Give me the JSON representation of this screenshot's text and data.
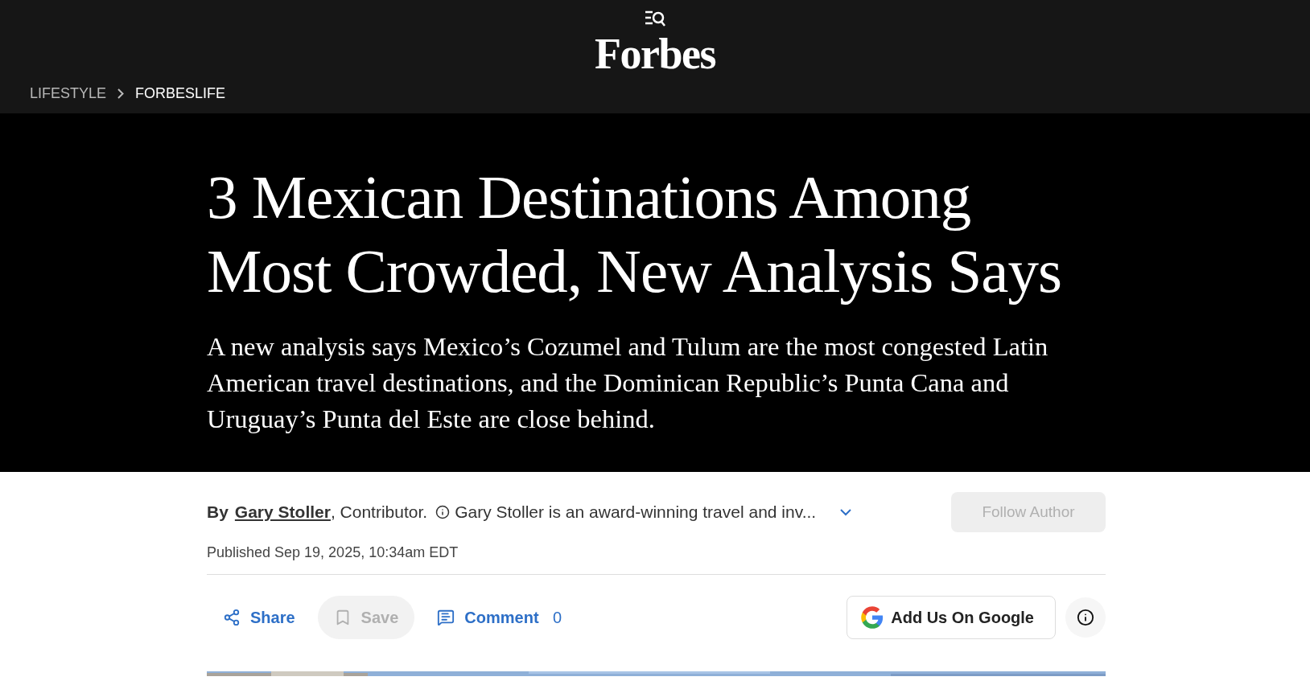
{
  "header": {
    "logo": "Forbes",
    "breadcrumb": [
      {
        "label": "LIFESTYLE",
        "selected": false
      },
      {
        "label": "FORBESLIFE",
        "selected": true
      }
    ]
  },
  "hero": {
    "title": "3 Mexican Destinations Among Most Crowded, New Analysis Says",
    "subtitle": "A new analysis says Mexico’s Cozumel and Tulum are the most congested Latin American travel destinations, and the Dominican Republic’s Punta Cana and Uruguay’s Punta del Este are close behind."
  },
  "byline": {
    "prefix": "By",
    "author": "Gary Stoller",
    "role": ", Contributor.",
    "bio": "Gary Stoller is an award-winning travel and inv...",
    "expanded": false,
    "follow": {
      "label": "Follow Author",
      "disabled": true
    },
    "published": "Published Sep 19, 2025, 10:34am EDT"
  },
  "actions": [
    {
      "kind": "share",
      "label": "Share"
    },
    {
      "kind": "save",
      "label": "Save",
      "disabled": true
    },
    {
      "kind": "comment",
      "label": "Comment",
      "count": "0"
    }
  ],
  "google_button": {
    "label": "Add Us On Google"
  }
}
